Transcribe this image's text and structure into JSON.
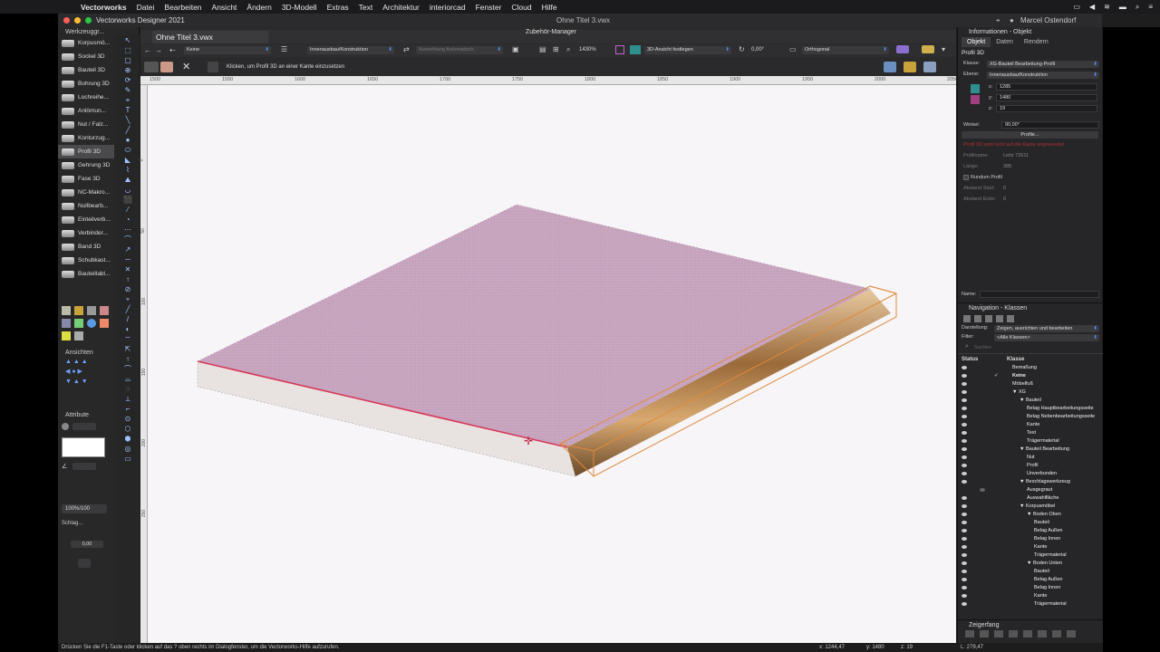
{
  "menubar": {
    "items": [
      "Vectorworks",
      "Datei",
      "Bearbeiten",
      "Ansicht",
      "Ändern",
      "3D-Modell",
      "Extras",
      "Text",
      "Architektur",
      "interiorcad",
      "Fenster",
      "Cloud",
      "Hilfe"
    ],
    "right_user": "Marcel Ostendorf"
  },
  "window": {
    "app_title": "Vectorworks Designer 2021",
    "doc_title": "Ohne Titel 3.vwx"
  },
  "palette": {
    "title": "Werkzeuggr...",
    "tools": [
      {
        "label": "Korpusmö..."
      },
      {
        "label": "Sockel 3D"
      },
      {
        "label": "Bauteil 3D"
      },
      {
        "label": "Bohrung 3D"
      },
      {
        "label": "Lochreihe..."
      },
      {
        "label": "Anlömun..."
      },
      {
        "label": "Nut / Falz..."
      },
      {
        "label": "Konturzug..."
      },
      {
        "label": "Profil 3D"
      },
      {
        "label": "Gehrung 3D"
      },
      {
        "label": "Fase 3D"
      },
      {
        "label": "NC-Makro..."
      },
      {
        "label": "Nullbearb..."
      },
      {
        "label": "Einteilverb..."
      },
      {
        "label": "Verbinder..."
      },
      {
        "label": "Band 3D"
      },
      {
        "label": "Schubkast..."
      },
      {
        "label": "Bauteillabl..."
      }
    ],
    "selected_tool": "Profil 3D",
    "views_title": "Ansichten",
    "attr_title": "Attribute",
    "opacity_label": "100%/100",
    "shadow_label": "Schlag...",
    "value_zero": "0,00"
  },
  "tabbar": {
    "tab": "Ohne Titel 3.vwx",
    "subwindow": "Zubehör-Manager"
  },
  "toolbar": {
    "class_dd": "Keine",
    "layer_dd": "Innenausbau/Konstruktion",
    "align_dd": "Ausrichtung Automatisch",
    "zoom": "1430%",
    "view3d": "3D-Ansicht festlegen",
    "angle": "0,00°",
    "projection": "Orthogonal"
  },
  "toolbar2": {
    "hint": "Klicken, um Profil 3D an einer Kante einzusetzen"
  },
  "ruler": {
    "labels": [
      "1500",
      "1550",
      "1600",
      "1650",
      "1700",
      "1750",
      "1800",
      "1850",
      "1900",
      "1950",
      "2000",
      "2050"
    ]
  },
  "vruler": {
    "labels": [
      "0",
      "50",
      "100",
      "150",
      "200",
      "250"
    ]
  },
  "info": {
    "header": "Informationen - Objekt",
    "tabs": [
      "Objekt",
      "Daten",
      "Rendern"
    ],
    "object_type": "Profil 3D",
    "class_label": "Klasse:",
    "class_value": "XG-Bauteil Bearbeitung-Profil",
    "layer_label": "Ebene:",
    "layer_value": "Innenausbau/Konstruktion",
    "x_label": "x:",
    "x": "1285",
    "y_label": "y:",
    "y": "1480",
    "z_label": "z:",
    "z": "19",
    "angle_label": "Winkel:",
    "angle": "90,00°",
    "profile_button": "Profile...",
    "warning": "Profil 3D wird nicht auf die Kante angewendet",
    "profname_label": "Profilname:",
    "profname": "Leitz 72611",
    "length_label": "Länge:",
    "length": "385",
    "rundum_label": "Rundum Profil",
    "start_label": "Abstand Start:",
    "start": "0",
    "end_label": "Abstand Ende:",
    "end": "0",
    "name_label": "Name:"
  },
  "navigation": {
    "header": "Navigation - Klassen",
    "display_label": "Darstellung:",
    "display_value": "Zeigen, ausrichten und bearbeiten",
    "filter_label": "Filter:",
    "filter_value": "<Alle Klassen>",
    "search_placeholder": "Suchen",
    "col_status": "Status",
    "col_class": "Klasse",
    "classes": [
      {
        "name": "Bemaßung",
        "indent": 0,
        "eye": "on"
      },
      {
        "name": "Keine",
        "indent": 0,
        "eye": "on",
        "active": true
      },
      {
        "name": "Möbelfuß",
        "indent": 0,
        "eye": "on"
      },
      {
        "name": "▼ XG",
        "indent": 0,
        "eye": "on"
      },
      {
        "name": "▼ Bauteil",
        "indent": 1,
        "eye": "on"
      },
      {
        "name": "Belag Hauptbearbeitungsseite",
        "indent": 2,
        "eye": "on"
      },
      {
        "name": "Belag Nebenbearbeitungsseite",
        "indent": 2,
        "eye": "on"
      },
      {
        "name": "Kante",
        "indent": 2,
        "eye": "on"
      },
      {
        "name": "Text",
        "indent": 2,
        "eye": "on"
      },
      {
        "name": "Trägermaterial",
        "indent": 2,
        "eye": "on"
      },
      {
        "name": "▼ Bauteil Bearbeitung",
        "indent": 1,
        "eye": "on"
      },
      {
        "name": "Nut",
        "indent": 2,
        "eye": "on"
      },
      {
        "name": "Profil",
        "indent": 2,
        "eye": "on"
      },
      {
        "name": "Unverbunden",
        "indent": 2,
        "eye": "on"
      },
      {
        "name": "▼ Beschlagswerkzeug",
        "indent": 1,
        "eye": "on"
      },
      {
        "name": "Ausgegraut",
        "indent": 2,
        "eye": "dim"
      },
      {
        "name": "Auswahlfläche",
        "indent": 2,
        "eye": "on"
      },
      {
        "name": "▼ Korpusmöbel",
        "indent": 1,
        "eye": "on"
      },
      {
        "name": "▼ Boden Oben",
        "indent": 2,
        "eye": "on"
      },
      {
        "name": "Bauteil",
        "indent": 3,
        "eye": "on"
      },
      {
        "name": "Belag Außen",
        "indent": 3,
        "eye": "on"
      },
      {
        "name": "Belag Innen",
        "indent": 3,
        "eye": "on"
      },
      {
        "name": "Kante",
        "indent": 3,
        "eye": "on"
      },
      {
        "name": "Trägermaterial",
        "indent": 3,
        "eye": "on"
      },
      {
        "name": "▼ Boden Unten",
        "indent": 2,
        "eye": "on"
      },
      {
        "name": "Bauteil",
        "indent": 3,
        "eye": "on"
      },
      {
        "name": "Belag Außen",
        "indent": 3,
        "eye": "on"
      },
      {
        "name": "Belag Innen",
        "indent": 3,
        "eye": "on"
      },
      {
        "name": "Kante",
        "indent": 3,
        "eye": "on"
      },
      {
        "name": "Trägermaterial",
        "indent": 3,
        "eye": "on"
      }
    ],
    "cursor_snap": "Zeigerfang"
  },
  "status": {
    "help": "Drücken Sie die F1-Taste oder klicken auf das ? oben rechts im Dialogfenster, um die Vectorworks-Hilfe aufzurufen.",
    "x": "x: 1244,47",
    "y": "y: 1480",
    "z": "z: 19",
    "l": "L: 279,47"
  },
  "colors": {
    "accent": "#4e90ff",
    "board_top": "#c8a6c0",
    "board_side": "#e8e2e0",
    "edge_red": "#d8385a",
    "profile_orange": "#e08a3a"
  }
}
